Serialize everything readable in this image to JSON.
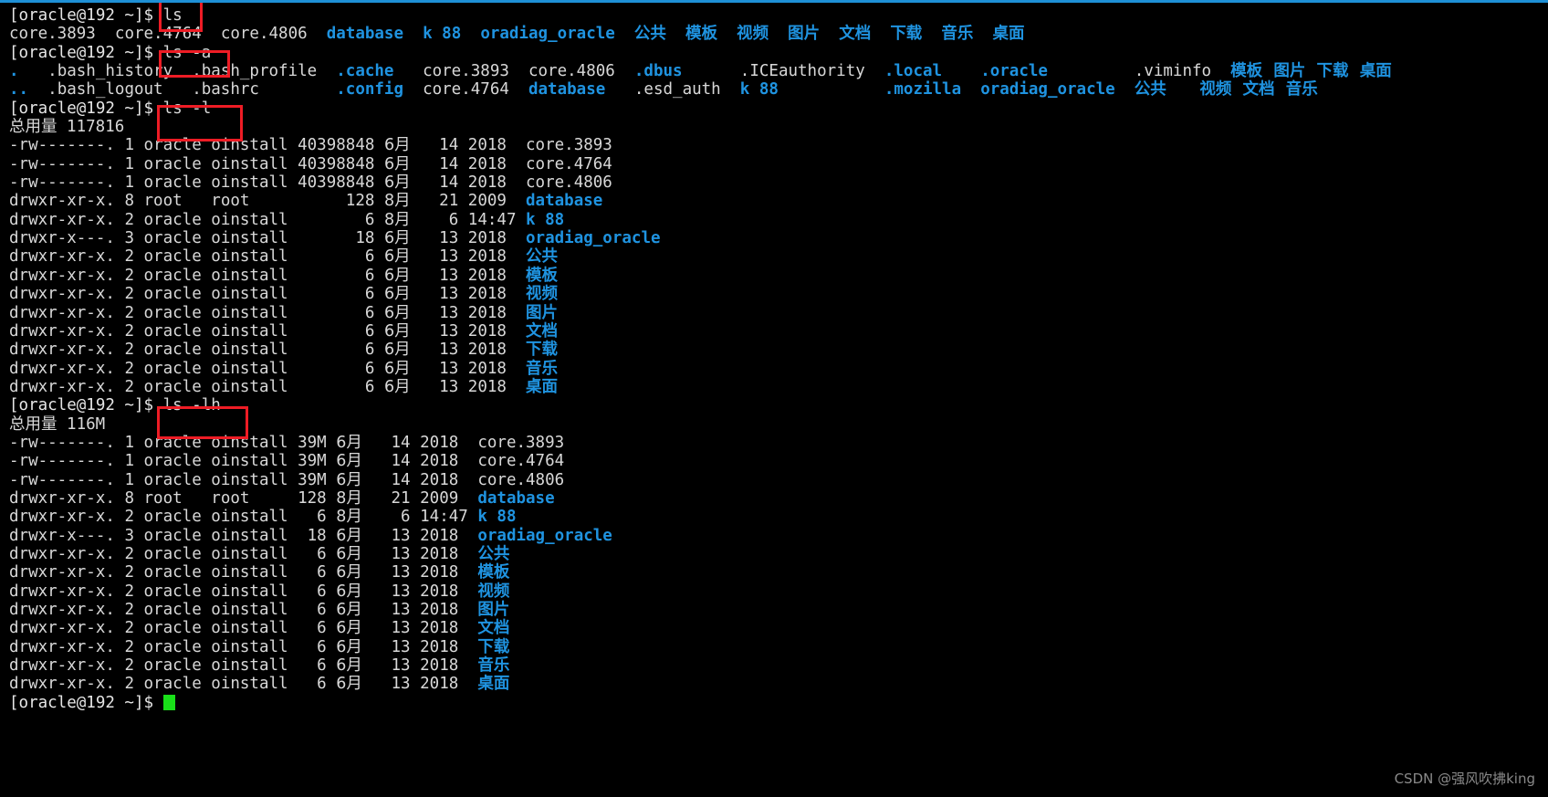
{
  "terminal": {
    "prompt": "[oracle@192 ~]$ ",
    "colors": {
      "background": "#000000",
      "foreground": "#d8d8d8",
      "directory_blue": "#1f93e0",
      "cursor_green": "#19e019",
      "highlight_red": "#ee1c25",
      "top_border_blue": "#1e90d6",
      "watermark_gray": "#8a8a8a"
    },
    "watermark": "CSDN @强风吹拂king",
    "cursor": "block-cursor"
  },
  "blocks": [
    {
      "id": "block-ls",
      "command": "ls",
      "highlighted": true,
      "output_lines": [
        "core.3893  core.4764  core.4806  database  k 88  oradiag_oracle  公共  模板  视频  图片  文档  下载  音乐  桌面"
      ]
    },
    {
      "id": "block-ls-a",
      "command": "ls -a",
      "highlighted": true,
      "output_lines": [
        ".   .bash_history  .bash_profile  .cache   core.3893  core.4806  .dbus      .ICEauthority  .local    .oracle         .viminfo  模板  图片  下载  桌面",
        "..  .bash_logout   .bashrc        .config  core.4764  database   .esd_auth  k 88           .mozilla  oradiag_oracle  公共      视频  文档  音乐"
      ]
    },
    {
      "id": "block-ls-l",
      "command": "ls -l",
      "highlighted": true,
      "total_label": "总用量",
      "total_value": "117816",
      "rows": [
        {
          "perms": "-rw-------.",
          "links": "1",
          "owner": "oracle",
          "group": "oinstall",
          "size": "40398848",
          "month": "6月",
          "day": "14",
          "time": "2018",
          "name": "core.3893",
          "is_dir": false
        },
        {
          "perms": "-rw-------.",
          "links": "1",
          "owner": "oracle",
          "group": "oinstall",
          "size": "40398848",
          "month": "6月",
          "day": "14",
          "time": "2018",
          "name": "core.4764",
          "is_dir": false
        },
        {
          "perms": "-rw-------.",
          "links": "1",
          "owner": "oracle",
          "group": "oinstall",
          "size": "40398848",
          "month": "6月",
          "day": "14",
          "time": "2018",
          "name": "core.4806",
          "is_dir": false
        },
        {
          "perms": "drwxr-xr-x.",
          "links": "8",
          "owner": "root",
          "group": "root",
          "size": "128",
          "month": "8月",
          "day": "21",
          "time": "2009",
          "name": "database",
          "is_dir": true
        },
        {
          "perms": "drwxr-xr-x.",
          "links": "2",
          "owner": "oracle",
          "group": "oinstall",
          "size": "6",
          "month": "8月",
          "day": "6",
          "time": "14:47",
          "name": "k 88",
          "is_dir": true
        },
        {
          "perms": "drwxr-x---.",
          "links": "3",
          "owner": "oracle",
          "group": "oinstall",
          "size": "18",
          "month": "6月",
          "day": "13",
          "time": "2018",
          "name": "oradiag_oracle",
          "is_dir": true
        },
        {
          "perms": "drwxr-xr-x.",
          "links": "2",
          "owner": "oracle",
          "group": "oinstall",
          "size": "6",
          "month": "6月",
          "day": "13",
          "time": "2018",
          "name": "公共",
          "is_dir": true
        },
        {
          "perms": "drwxr-xr-x.",
          "links": "2",
          "owner": "oracle",
          "group": "oinstall",
          "size": "6",
          "month": "6月",
          "day": "13",
          "time": "2018",
          "name": "模板",
          "is_dir": true
        },
        {
          "perms": "drwxr-xr-x.",
          "links": "2",
          "owner": "oracle",
          "group": "oinstall",
          "size": "6",
          "month": "6月",
          "day": "13",
          "time": "2018",
          "name": "视频",
          "is_dir": true
        },
        {
          "perms": "drwxr-xr-x.",
          "links": "2",
          "owner": "oracle",
          "group": "oinstall",
          "size": "6",
          "month": "6月",
          "day": "13",
          "time": "2018",
          "name": "图片",
          "is_dir": true
        },
        {
          "perms": "drwxr-xr-x.",
          "links": "2",
          "owner": "oracle",
          "group": "oinstall",
          "size": "6",
          "month": "6月",
          "day": "13",
          "time": "2018",
          "name": "文档",
          "is_dir": true
        },
        {
          "perms": "drwxr-xr-x.",
          "links": "2",
          "owner": "oracle",
          "group": "oinstall",
          "size": "6",
          "month": "6月",
          "day": "13",
          "time": "2018",
          "name": "下载",
          "is_dir": true
        },
        {
          "perms": "drwxr-xr-x.",
          "links": "2",
          "owner": "oracle",
          "group": "oinstall",
          "size": "6",
          "month": "6月",
          "day": "13",
          "time": "2018",
          "name": "音乐",
          "is_dir": true
        },
        {
          "perms": "drwxr-xr-x.",
          "links": "2",
          "owner": "oracle",
          "group": "oinstall",
          "size": "6",
          "month": "6月",
          "day": "13",
          "time": "2018",
          "name": "桌面",
          "is_dir": true
        }
      ]
    },
    {
      "id": "block-ls-lh",
      "command": "ls -lh",
      "highlighted": true,
      "total_label": "总用量",
      "total_value": "116M",
      "rows": [
        {
          "perms": "-rw-------.",
          "links": "1",
          "owner": "oracle",
          "group": "oinstall",
          "size": "39M",
          "month": "6月",
          "day": "14",
          "time": "2018",
          "name": "core.3893",
          "is_dir": false
        },
        {
          "perms": "-rw-------.",
          "links": "1",
          "owner": "oracle",
          "group": "oinstall",
          "size": "39M",
          "month": "6月",
          "day": "14",
          "time": "2018",
          "name": "core.4764",
          "is_dir": false
        },
        {
          "perms": "-rw-------.",
          "links": "1",
          "owner": "oracle",
          "group": "oinstall",
          "size": "39M",
          "month": "6月",
          "day": "14",
          "time": "2018",
          "name": "core.4806",
          "is_dir": false
        },
        {
          "perms": "drwxr-xr-x.",
          "links": "8",
          "owner": "root",
          "group": "root",
          "size": "128",
          "month": "8月",
          "day": "21",
          "time": "2009",
          "name": "database",
          "is_dir": true
        },
        {
          "perms": "drwxr-xr-x.",
          "links": "2",
          "owner": "oracle",
          "group": "oinstall",
          "size": "6",
          "month": "8月",
          "day": "6",
          "time": "14:47",
          "name": "k 88",
          "is_dir": true
        },
        {
          "perms": "drwxr-x---.",
          "links": "3",
          "owner": "oracle",
          "group": "oinstall",
          "size": "18",
          "month": "6月",
          "day": "13",
          "time": "2018",
          "name": "oradiag_oracle",
          "is_dir": true
        },
        {
          "perms": "drwxr-xr-x.",
          "links": "2",
          "owner": "oracle",
          "group": "oinstall",
          "size": "6",
          "month": "6月",
          "day": "13",
          "time": "2018",
          "name": "公共",
          "is_dir": true
        },
        {
          "perms": "drwxr-xr-x.",
          "links": "2",
          "owner": "oracle",
          "group": "oinstall",
          "size": "6",
          "month": "6月",
          "day": "13",
          "time": "2018",
          "name": "模板",
          "is_dir": true
        },
        {
          "perms": "drwxr-xr-x.",
          "links": "2",
          "owner": "oracle",
          "group": "oinstall",
          "size": "6",
          "month": "6月",
          "day": "13",
          "time": "2018",
          "name": "视频",
          "is_dir": true
        },
        {
          "perms": "drwxr-xr-x.",
          "links": "2",
          "owner": "oracle",
          "group": "oinstall",
          "size": "6",
          "month": "6月",
          "day": "13",
          "time": "2018",
          "name": "图片",
          "is_dir": true
        },
        {
          "perms": "drwxr-xr-x.",
          "links": "2",
          "owner": "oracle",
          "group": "oinstall",
          "size": "6",
          "month": "6月",
          "day": "13",
          "time": "2018",
          "name": "文档",
          "is_dir": true
        },
        {
          "perms": "drwxr-xr-x.",
          "links": "2",
          "owner": "oracle",
          "group": "oinstall",
          "size": "6",
          "month": "6月",
          "day": "13",
          "time": "2018",
          "name": "下载",
          "is_dir": true
        },
        {
          "perms": "drwxr-xr-x.",
          "links": "2",
          "owner": "oracle",
          "group": "oinstall",
          "size": "6",
          "month": "6月",
          "day": "13",
          "time": "2018",
          "name": "音乐",
          "is_dir": true
        },
        {
          "perms": "drwxr-xr-x.",
          "links": "2",
          "owner": "oracle",
          "group": "oinstall",
          "size": "6",
          "month": "6月",
          "day": "13",
          "time": "2018",
          "name": "桌面",
          "is_dir": true
        }
      ]
    }
  ],
  "ls_plain_entries": [
    {
      "name": "core.3893",
      "is_dir": false
    },
    {
      "name": "core.4764",
      "is_dir": false
    },
    {
      "name": "core.4806",
      "is_dir": false
    },
    {
      "name": "database",
      "is_dir": true
    },
    {
      "name": "k 88",
      "is_dir": true
    },
    {
      "name": "oradiag_oracle",
      "is_dir": true
    },
    {
      "name": "公共",
      "is_dir": true
    },
    {
      "name": "模板",
      "is_dir": true
    },
    {
      "name": "视频",
      "is_dir": true
    },
    {
      "name": "图片",
      "is_dir": true
    },
    {
      "name": "文档",
      "is_dir": true
    },
    {
      "name": "下载",
      "is_dir": true
    },
    {
      "name": "音乐",
      "is_dir": true
    },
    {
      "name": "桌面",
      "is_dir": true
    }
  ],
  "ls_a_grid": {
    "row1": [
      {
        "t": ".",
        "c": "blue",
        "w": 4
      },
      {
        "t": ".bash_history",
        "c": "w",
        "w": 15
      },
      {
        "t": ".bash_profile",
        "c": "w",
        "w": 15
      },
      {
        "t": ".cache",
        "c": "blue",
        "w": 9
      },
      {
        "t": "core.3893",
        "c": "w",
        "w": 11
      },
      {
        "t": "core.4806",
        "c": "w",
        "w": 11
      },
      {
        "t": ".dbus",
        "c": "blue",
        "w": 11
      },
      {
        "t": ".ICEauthority",
        "c": "w",
        "w": 15
      },
      {
        "t": ".local",
        "c": "blue",
        "w": 10
      },
      {
        "t": ".oracle",
        "c": "blue",
        "w": 16
      },
      {
        "t": ".viminfo",
        "c": "w",
        "w": 10
      },
      {
        "t": "模板",
        "c": "cn",
        "w": 6
      },
      {
        "t": "图片",
        "c": "cn",
        "w": 6
      },
      {
        "t": "下载",
        "c": "cn",
        "w": 6
      },
      {
        "t": "桌面",
        "c": "cn",
        "w": 6
      }
    ],
    "row2": [
      {
        "t": "..",
        "c": "blue",
        "w": 4
      },
      {
        "t": ".bash_logout",
        "c": "w",
        "w": 15
      },
      {
        "t": ".bashrc",
        "c": "w",
        "w": 15
      },
      {
        "t": ".config",
        "c": "blue",
        "w": 9
      },
      {
        "t": "core.4764",
        "c": "w",
        "w": 11
      },
      {
        "t": "database",
        "c": "blue",
        "w": 11
      },
      {
        "t": ".esd_auth",
        "c": "w",
        "w": 11
      },
      {
        "t": "k 88",
        "c": "blue",
        "w": 15
      },
      {
        "t": ".mozilla",
        "c": "blue",
        "w": 10
      },
      {
        "t": "oradiag_oracle",
        "c": "blue",
        "w": 16
      },
      {
        "t": "公共",
        "c": "cn",
        "w": 10
      },
      {
        "t": "视频",
        "c": "cn",
        "w": 6
      },
      {
        "t": "文档",
        "c": "cn",
        "w": 6
      },
      {
        "t": "音乐",
        "c": "cn",
        "w": 6
      }
    ]
  }
}
